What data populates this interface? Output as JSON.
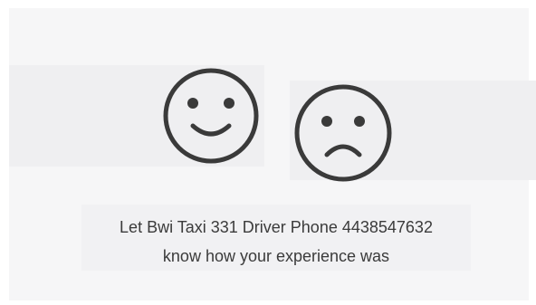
{
  "feedback": {
    "happy_face_icon": "smiley-face-icon",
    "sad_face_icon": "frowning-face-icon",
    "message_line1": "Let Bwi Taxi 331 Driver Phone 4438547632",
    "message_line2": "know how your experience was"
  },
  "colors": {
    "icon_stroke": "#3a3a3a",
    "text": "#3b3b3b",
    "card_background": "#f6f6f7",
    "panel_background": "#efeff1"
  }
}
